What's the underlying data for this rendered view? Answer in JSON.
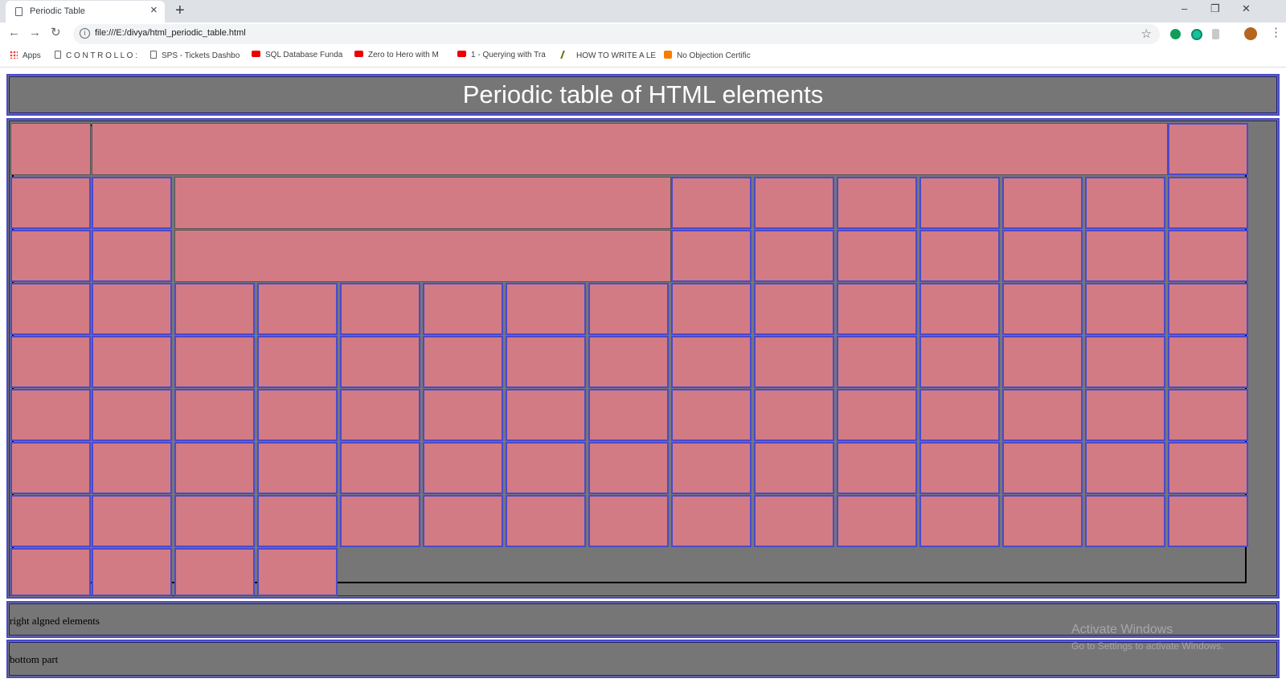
{
  "browser": {
    "tab_title": "Periodic Table",
    "tab_close": "×",
    "new_tab": "+",
    "window_controls": {
      "minimize": "–",
      "restore": "❐",
      "close": "✕"
    },
    "nav": {
      "back": "←",
      "forward": "→",
      "reload": "↻"
    },
    "url": "file:///E:/divya/html_periodic_table.html",
    "star": "☆",
    "menu": "⋮",
    "bookmarks": [
      {
        "label": "Apps",
        "icon": "apps-icon"
      },
      {
        "label": "C O N T R O L L O :",
        "icon": "page-icon"
      },
      {
        "label": "SPS - Tickets Dashbo",
        "icon": "page-icon"
      },
      {
        "label": "SQL Database Funda",
        "icon": "youtube-icon"
      },
      {
        "label": "Zero to Hero with M",
        "icon": "youtube-icon"
      },
      {
        "label": "1 - Querying with Tra",
        "icon": "youtube-icon"
      },
      {
        "label": "HOW TO WRITE A LE",
        "icon": "pen-icon"
      },
      {
        "label": "No Objection Certific",
        "icon": "blogger-icon"
      }
    ]
  },
  "page": {
    "heading": "Periodic table of HTML elements",
    "footer_right": "right algned elements",
    "footer_bottom": "bottom part",
    "cell_color": "#d27b84",
    "background_color": "#767676",
    "border_color": "#4a4acc"
  },
  "watermark": {
    "line1": "Activate Windows",
    "line2": "Go to Settings to activate Windows."
  }
}
